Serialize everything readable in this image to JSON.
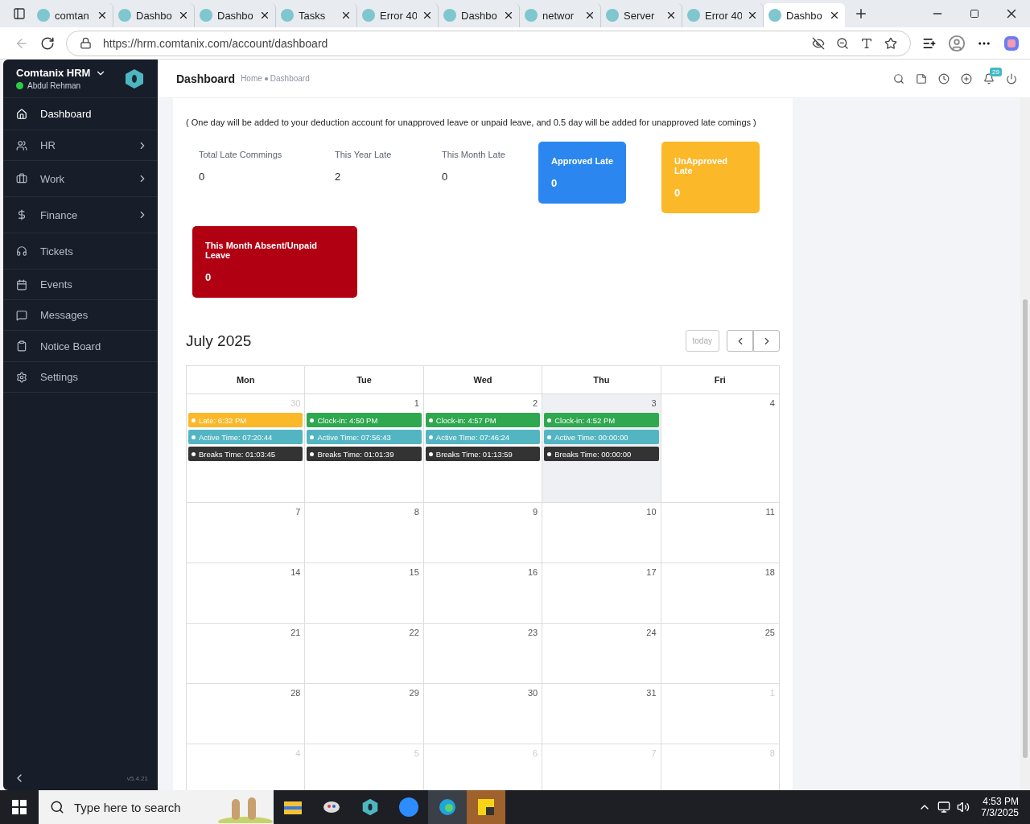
{
  "browser": {
    "tabs": [
      {
        "title": "comtan",
        "selected": false
      },
      {
        "title": "Dashbo",
        "selected": false
      },
      {
        "title": "Dashbo",
        "selected": false
      },
      {
        "title": "Tasks",
        "selected": false
      },
      {
        "title": "Error 40",
        "selected": false
      },
      {
        "title": "Dashbo",
        "selected": false
      },
      {
        "title": "networ",
        "selected": false
      },
      {
        "title": "Server",
        "selected": false
      },
      {
        "title": "Error 40",
        "selected": false
      },
      {
        "title": "Dashbo",
        "selected": true
      }
    ],
    "url": "https://hrm.comtanix.com/account/dashboard"
  },
  "sidebar": {
    "app_name": "Comtanix HRM",
    "user": "Abdul Rehman",
    "online": true,
    "version": "v5.4.21",
    "items": [
      {
        "label": "Dashboard",
        "selected": true,
        "expandable": false
      },
      {
        "label": "HR",
        "selected": false,
        "expandable": true
      },
      {
        "label": "Work",
        "selected": false,
        "expandable": true
      },
      {
        "label": "Finance",
        "selected": false,
        "expandable": true
      },
      {
        "label": "Tickets",
        "selected": false,
        "expandable": false
      },
      {
        "label": "Events",
        "selected": false,
        "expandable": false
      },
      {
        "label": "Messages",
        "selected": false,
        "expandable": false
      },
      {
        "label": "Notice Board",
        "selected": false,
        "expandable": false
      },
      {
        "label": "Settings",
        "selected": false,
        "expandable": false
      }
    ]
  },
  "header": {
    "title": "Dashboard",
    "breadcrumb": [
      "Home",
      "Dashboard"
    ],
    "notification_count": "29"
  },
  "attendance": {
    "note": "( One day will be added to your deduction account for unapproved leave or unpaid leave, and 0.5 day will be added for unapproved late comings )",
    "stats": [
      {
        "kind": "plain",
        "label": "Total Late Commings",
        "value": "0"
      },
      {
        "kind": "plain",
        "label": "This Year Late",
        "value": "2"
      },
      {
        "kind": "plain",
        "label": "This Month Late",
        "value": "0"
      },
      {
        "kind": "card",
        "label": "Approved Late",
        "value": "0",
        "color": "#2b87ef"
      },
      {
        "kind": "card",
        "label": "UnApproved Late",
        "value": "0",
        "color": "#fbb829"
      },
      {
        "kind": "card",
        "label": "This Month Absent/Unpaid Leave",
        "value": "0",
        "color": "#b10012"
      }
    ]
  },
  "calendar": {
    "title": "July 2025",
    "today_button": {
      "label": "today",
      "disabled": true
    },
    "weekdays": [
      "Mon",
      "Tue",
      "Wed",
      "Thu",
      "Fri"
    ],
    "weeks": [
      [
        {
          "day": "30",
          "muted": true,
          "today": false,
          "events": [
            {
              "kind": "late",
              "text": "Late: 6:32 PM"
            },
            {
              "kind": "active",
              "text": "Active Time: 07:20:44"
            },
            {
              "kind": "breaks",
              "text": "Breaks Time: 01:03:45"
            }
          ]
        },
        {
          "day": "1",
          "muted": false,
          "today": false,
          "events": [
            {
              "kind": "clockin",
              "text": "Clock-in: 4:50 PM"
            },
            {
              "kind": "active",
              "text": "Active Time: 07:56:43"
            },
            {
              "kind": "breaks",
              "text": "Breaks Time: 01:01:39"
            }
          ]
        },
        {
          "day": "2",
          "muted": false,
          "today": false,
          "events": [
            {
              "kind": "clockin",
              "text": "Clock-in: 4:57 PM"
            },
            {
              "kind": "active",
              "text": "Active Time: 07:46:24"
            },
            {
              "kind": "breaks",
              "text": "Breaks Time: 01:13:59"
            }
          ]
        },
        {
          "day": "3",
          "muted": false,
          "today": true,
          "events": [
            {
              "kind": "clockin",
              "text": "Clock-in: 4:52 PM"
            },
            {
              "kind": "active",
              "text": "Active Time: 00:00:00"
            },
            {
              "kind": "breaks",
              "text": "Breaks Time: 00:00:00"
            }
          ]
        },
        {
          "day": "4",
          "muted": false,
          "today": false
        }
      ],
      [
        {
          "day": "7",
          "muted": false,
          "today": false
        },
        {
          "day": "8",
          "muted": false,
          "today": false
        },
        {
          "day": "9",
          "muted": false,
          "today": false
        },
        {
          "day": "10",
          "muted": false,
          "today": false
        },
        {
          "day": "11",
          "muted": false,
          "today": false
        }
      ],
      [
        {
          "day": "14",
          "muted": false,
          "today": false
        },
        {
          "day": "15",
          "muted": false,
          "today": false
        },
        {
          "day": "16",
          "muted": false,
          "today": false
        },
        {
          "day": "17",
          "muted": false,
          "today": false
        },
        {
          "day": "18",
          "muted": false,
          "today": false
        }
      ],
      [
        {
          "day": "21",
          "muted": false,
          "today": false
        },
        {
          "day": "22",
          "muted": false,
          "today": false
        },
        {
          "day": "23",
          "muted": false,
          "today": false
        },
        {
          "day": "24",
          "muted": false,
          "today": false
        },
        {
          "day": "25",
          "muted": false,
          "today": false
        }
      ],
      [
        {
          "day": "28",
          "muted": false,
          "today": false
        },
        {
          "day": "29",
          "muted": false,
          "today": false
        },
        {
          "day": "30",
          "muted": false,
          "today": false
        },
        {
          "day": "31",
          "muted": false,
          "today": false
        },
        {
          "day": "1",
          "muted": true,
          "today": false
        }
      ],
      [
        {
          "day": "4",
          "muted": true,
          "today": false
        },
        {
          "day": "5",
          "muted": true,
          "today": false
        },
        {
          "day": "6",
          "muted": true,
          "today": false
        },
        {
          "day": "7",
          "muted": true,
          "today": false
        },
        {
          "day": "8",
          "muted": true,
          "today": false
        }
      ]
    ]
  },
  "taskbar": {
    "search_placeholder": "Type here to search",
    "time": "4:53 PM",
    "date": "7/3/2025"
  }
}
